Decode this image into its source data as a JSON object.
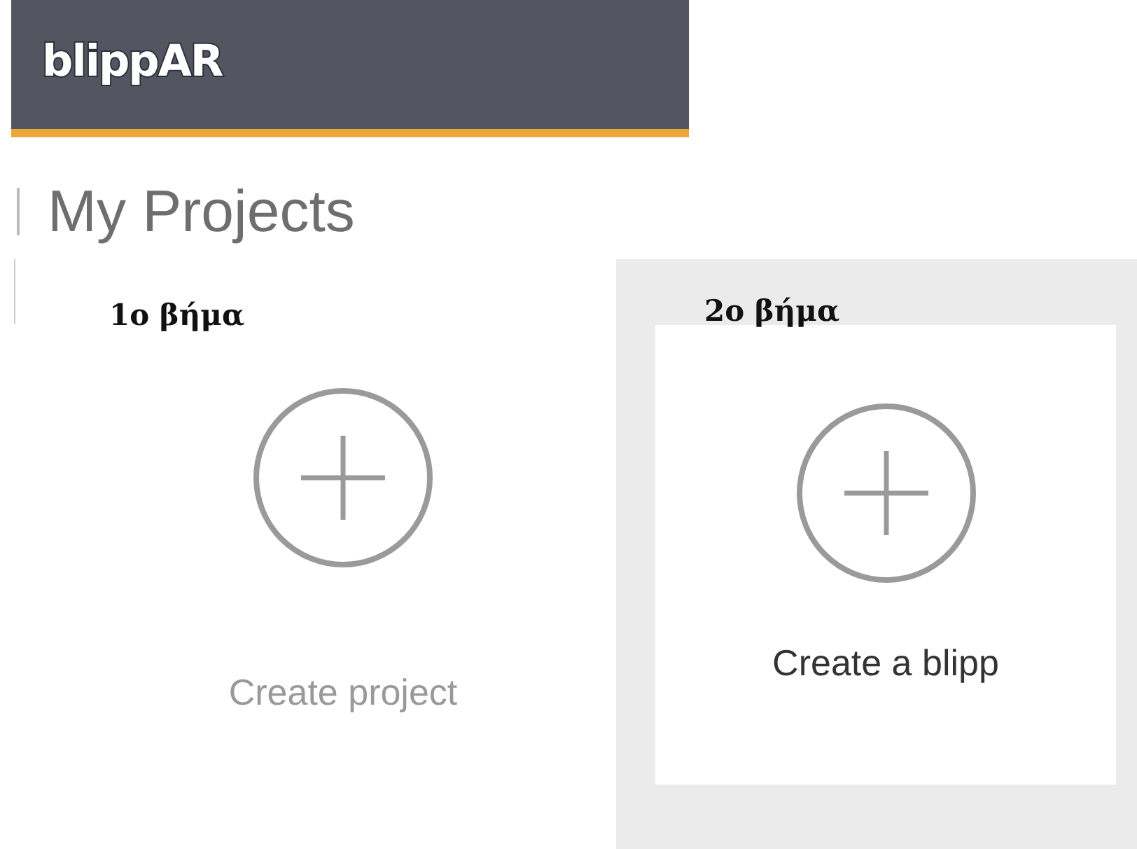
{
  "header": {
    "logo": "blippAR"
  },
  "page_title": "My Projects",
  "cards": [
    {
      "step_label": "1o βήμα",
      "label": "Create project",
      "selected": false
    },
    {
      "step_label": "2o βήμα",
      "label": "Create a blipp",
      "selected": true
    }
  ]
}
